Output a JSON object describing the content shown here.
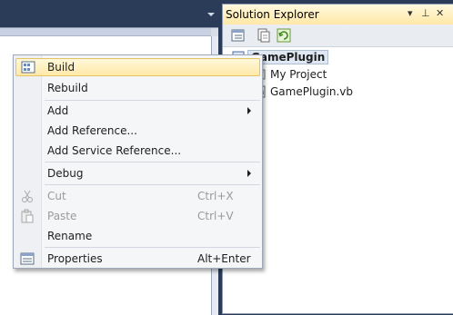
{
  "solution_explorer": {
    "title": "Solution Explorer",
    "controls": {
      "dropdown": "▾",
      "pin": "⊥",
      "close": "✕"
    },
    "tree": [
      {
        "label": "GamePlugin",
        "icon": "vb-project-icon",
        "selected": true
      },
      {
        "label": "My Project",
        "icon": "wrench-icon"
      },
      {
        "label": "GamePlugin.vb",
        "icon": "vb-file-icon"
      }
    ]
  },
  "context_menu": {
    "items": [
      {
        "label": "Build",
        "icon": "build-icon",
        "highlighted": true
      },
      {
        "label": "Rebuild"
      },
      {
        "label": "Add",
        "submenu": true
      },
      {
        "label": "Add Reference..."
      },
      {
        "label": "Add Service Reference..."
      },
      {
        "label": "Debug",
        "submenu": true
      },
      {
        "label": "Cut",
        "shortcut": "Ctrl+X",
        "disabled": true,
        "icon": "scissors-icon"
      },
      {
        "label": "Paste",
        "shortcut": "Ctrl+V",
        "disabled": true,
        "icon": "paste-icon"
      },
      {
        "label": "Rename"
      },
      {
        "label": "Properties",
        "shortcut": "Alt+Enter",
        "icon": "properties-icon"
      }
    ]
  },
  "colors": {
    "background": "#2b3c59",
    "highlight": "#ffe9a8",
    "disabled_text": "#9a9a9a"
  }
}
